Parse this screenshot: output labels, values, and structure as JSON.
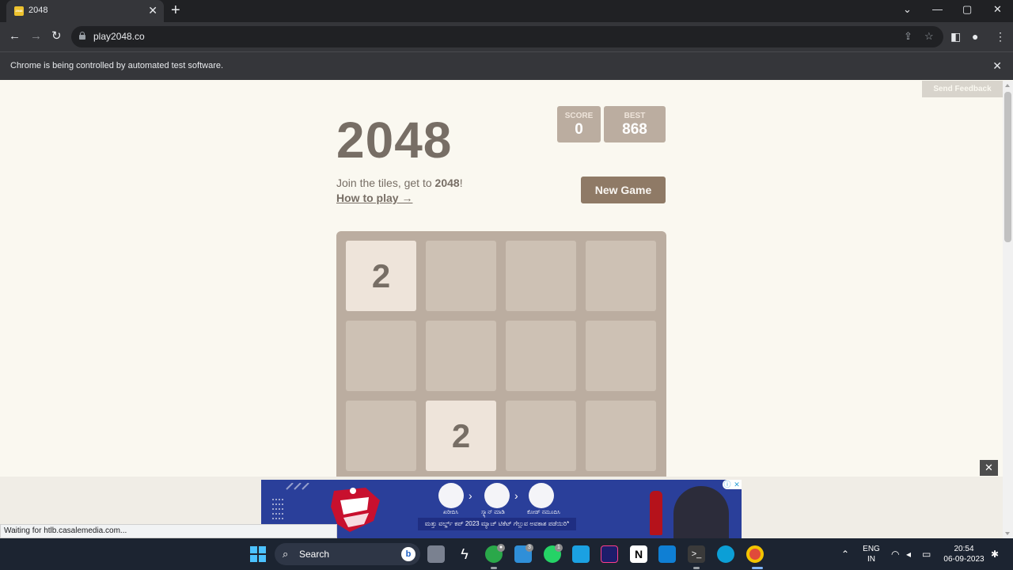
{
  "browser": {
    "tab_title": "2048",
    "favicon_text": "2048",
    "url": "play2048.co",
    "infobar_message": "Chrome is being controlled by automated test software."
  },
  "page": {
    "feedback_label": "Send Feedback",
    "title": "2048",
    "score_label": "SCORE",
    "score_value": "0",
    "best_label": "BEST",
    "best_value": "868",
    "intro_prefix": "Join the tiles, get to ",
    "intro_target": "2048",
    "intro_suffix": "!",
    "how_to_play": "How to play →",
    "new_game_label": "New Game",
    "board": {
      "tiles": [
        {
          "row": 0,
          "col": 0,
          "value": "2"
        },
        {
          "row": 2,
          "col": 1,
          "value": "2"
        }
      ]
    }
  },
  "ad": {
    "close_label": "✕",
    "adchoices": "ⓘ",
    "ad_x": "✕",
    "step1_label": "ಖರೀದಿಸಿ",
    "step2_label": "ಸ್ಕ್ಯಾನ್ ಮಾಡಿ",
    "step3_label": "ಕೋಡ್ ನಮೂದಿಸಿ",
    "banner_text": "ಮತ್ತು ವರ್ಲ್ಡ್ ಕಪ್ 2023 ಮ್ಯಾಚ್ ಟಿಕೆಟ್ ಗೆಲ್ಲುವ ಅವಕಾಶ ಪಡೆಯಿರಿ*"
  },
  "status_text": "Waiting for htlb.casalemedia.com...",
  "taskbar": {
    "search_label": "Search",
    "mail_badge": "3",
    "whatsapp_badge": "1",
    "lang_line1": "ENG",
    "lang_line2": "IN",
    "time": "20:54",
    "date": "06-09-2023"
  },
  "colors": {
    "tile_2": "#eee4da",
    "empty_cell": "#cdc1b4",
    "board": "#bbada0",
    "new_game": "#8f7a66"
  }
}
